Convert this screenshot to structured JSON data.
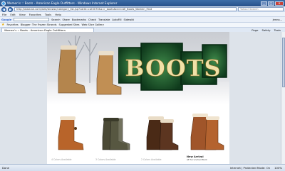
{
  "window": {
    "title": "Women's :: Boots - American Eagle Outfitters - Windows Internet Explorer",
    "min": "_",
    "max": "□",
    "close": "✕"
  },
  "address": {
    "back": "◀",
    "forward": "▶",
    "url": "http://www.ae.com/web/browse/category_list.jsp?catId=cat3070&s=r_boots&icid=AE_Boots_Women_Feat",
    "search_placeholder": "Yahoo! Search"
  },
  "menu": [
    "File",
    "Edit",
    "View",
    "Favorites",
    "Tools",
    "Help"
  ],
  "google": {
    "label": "Google",
    "items": [
      "Search",
      "Share",
      "Bookmarks",
      "Check",
      "Translate",
      "AutoFill",
      "Sidewiki",
      "jenna..."
    ]
  },
  "favorites": {
    "label": "Favorites",
    "items": [
      "Blogger: The Frozen Strands",
      "Suggested Sites",
      "Web Slice Gallery"
    ]
  },
  "tab": {
    "label": "Women's :: Boots - American Eagle Outfitters",
    "commands": [
      "Page",
      "Safety",
      "Tools"
    ]
  },
  "hero": {
    "sign_text": "BOOTS"
  },
  "products": [
    {
      "caption": "4 Colors Available"
    },
    {
      "caption": "3 Colors Available"
    },
    {
      "caption": "2 Colors Available"
    },
    {
      "badge": "New Arrival",
      "caption": "AE Scrunched Boot"
    }
  ],
  "status": {
    "text": "Done",
    "zone": "Internet | Protected Mode: On",
    "zoom": "100%"
  }
}
